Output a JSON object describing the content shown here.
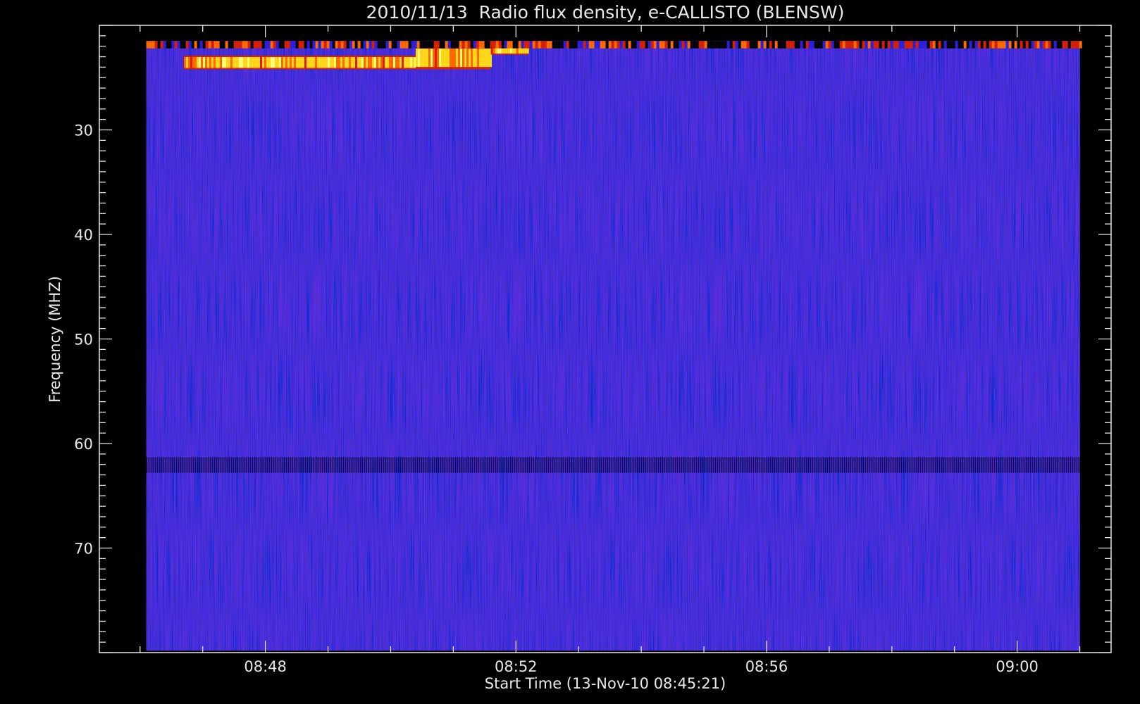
{
  "chart_data": {
    "type": "heatmap",
    "title": "2010/11/13  Radio flux density, e-CALLISTO (BLENSW)",
    "xlabel": "Start Time (13-Nov-10 08:45:21)",
    "ylabel": "Frequency (MHZ)",
    "x_tick_labels": [
      "08:48",
      "08:52",
      "08:56",
      "09:00"
    ],
    "x_tick_minutes": [
      48,
      52,
      56,
      60
    ],
    "y_tick_labels": [
      "30",
      "40",
      "50",
      "60",
      "70"
    ],
    "y_tick_values": [
      30,
      40,
      50,
      60,
      70
    ],
    "xlim_minutes": [
      45.35,
      61.5
    ],
    "ylim": [
      20,
      80
    ],
    "data_x_range_minutes": [
      46.1,
      61.0
    ],
    "data_y_range": [
      21.5,
      79.8
    ],
    "y_axis_inverted": true,
    "grid": false,
    "legend": "none",
    "colormap": [
      "#000000",
      "#1a1ae6",
      "#2b1fd8",
      "#8a1030",
      "#d62000",
      "#ff6a00",
      "#ffd81a",
      "#ffff7a"
    ],
    "background": "#0a14f5",
    "features": [
      {
        "kind": "burst",
        "t_start": 46.7,
        "t_end": 50.4,
        "f_low": 22.9,
        "f_high": 24.2,
        "level": "high"
      },
      {
        "kind": "burst",
        "t_start": 50.4,
        "t_end": 51.6,
        "f_low": 22.0,
        "f_high": 24.2,
        "level": "high"
      },
      {
        "kind": "burst",
        "t_start": 51.6,
        "t_end": 52.2,
        "f_low": 21.8,
        "f_high": 22.8,
        "level": "high"
      },
      {
        "kind": "band",
        "t_start": 46.1,
        "t_end": 61.0,
        "f_low": 21.5,
        "f_high": 22.2,
        "level": "spiky"
      },
      {
        "kind": "band",
        "t_start": 46.1,
        "t_end": 61.0,
        "f_low": 61.3,
        "f_high": 62.8,
        "level": "dark"
      }
    ]
  }
}
